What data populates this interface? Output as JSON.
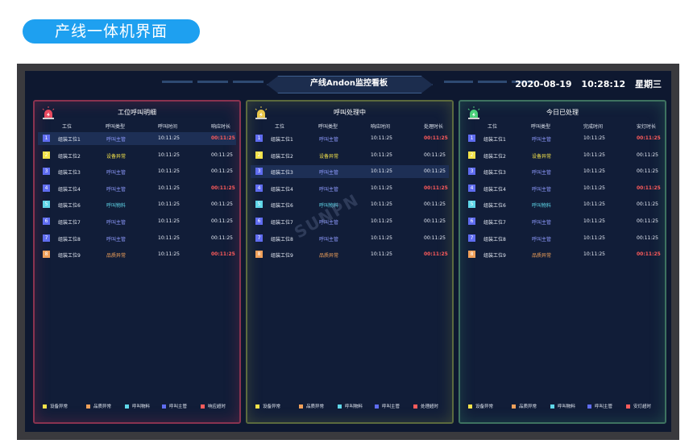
{
  "heading": "产线一体机界面",
  "screen_title": "产线Andon监控看板",
  "datetime": {
    "date": "2020-08-19",
    "time": "10:28:12",
    "weekday": "星期三"
  },
  "watermark": "SUNPN",
  "colors": {
    "equipment": "#f3e24a",
    "quality": "#f0a05a",
    "material": "#5fd6e8",
    "supervisor": "#5f6cf0",
    "timeout": "#ff5b5b"
  },
  "panels": [
    {
      "title": "工位呼叫明细",
      "icon": "red-alarm-icon",
      "headers": [
        "工位",
        "呼叫类型",
        "呼叫时间",
        "响应时长"
      ],
      "highlight_row": 0,
      "rows": [
        {
          "num": "1",
          "station": "组装工位1",
          "type": "呼叫主管",
          "type_color": "#8f9bff",
          "num_color": "#5f6cf0",
          "time": "10:11:25",
          "dur": "00:11:25",
          "timeout": true
        },
        {
          "num": "2",
          "station": "组装工位2",
          "type": "设备异常",
          "type_color": "#f3e24a",
          "num_color": "#f3e24a",
          "time": "10:11:25",
          "dur": "00:11:25",
          "timeout": false
        },
        {
          "num": "3",
          "station": "组装工位3",
          "type": "呼叫主管",
          "type_color": "#8f9bff",
          "num_color": "#5f6cf0",
          "time": "10:11:25",
          "dur": "00:11:25",
          "timeout": false
        },
        {
          "num": "4",
          "station": "组装工位4",
          "type": "呼叫主管",
          "type_color": "#8f9bff",
          "num_color": "#5f6cf0",
          "time": "10:11:25",
          "dur": "00:11:25",
          "timeout": true
        },
        {
          "num": "5",
          "station": "组装工位6",
          "type": "呼叫物料",
          "type_color": "#5fd6e8",
          "num_color": "#5fd6e8",
          "time": "10:11:25",
          "dur": "00:11:25",
          "timeout": false
        },
        {
          "num": "6",
          "station": "组装工位7",
          "type": "呼叫主管",
          "type_color": "#8f9bff",
          "num_color": "#5f6cf0",
          "time": "10:11:25",
          "dur": "00:11:25",
          "timeout": false
        },
        {
          "num": "7",
          "station": "组装工位8",
          "type": "呼叫主管",
          "type_color": "#8f9bff",
          "num_color": "#5f6cf0",
          "time": "10:11:25",
          "dur": "00:11:25",
          "timeout": false
        },
        {
          "num": "8",
          "station": "组装工位9",
          "type": "品质异常",
          "type_color": "#f0a05a",
          "num_color": "#f0a05a",
          "time": "10:11:25",
          "dur": "00:11:25",
          "timeout": true
        }
      ],
      "legend": [
        {
          "label": "设备异常",
          "color": "#f3e24a"
        },
        {
          "label": "品质异常",
          "color": "#f0a05a"
        },
        {
          "label": "呼叫物料",
          "color": "#5fd6e8"
        },
        {
          "label": "呼叫主管",
          "color": "#5f6cf0"
        },
        {
          "label": "响应超时",
          "color": "#ff5b5b"
        }
      ]
    },
    {
      "title": "呼叫处理中",
      "icon": "yellow-alarm-icon",
      "headers": [
        "工位",
        "呼叫类型",
        "响应时间",
        "处理时长"
      ],
      "highlight_row": 2,
      "rows": [
        {
          "num": "1",
          "station": "组装工位1",
          "type": "呼叫主管",
          "type_color": "#8f9bff",
          "num_color": "#5f6cf0",
          "time": "10:11:25",
          "dur": "00:11:25",
          "timeout": true
        },
        {
          "num": "2",
          "station": "组装工位2",
          "type": "设备异常",
          "type_color": "#f3e24a",
          "num_color": "#f3e24a",
          "time": "10:11:25",
          "dur": "00:11:25",
          "timeout": false
        },
        {
          "num": "3",
          "station": "组装工位3",
          "type": "呼叫主管",
          "type_color": "#8f9bff",
          "num_color": "#5f6cf0",
          "time": "10:11:25",
          "dur": "00:11:25",
          "timeout": false
        },
        {
          "num": "4",
          "station": "组装工位4",
          "type": "呼叫主管",
          "type_color": "#8f9bff",
          "num_color": "#5f6cf0",
          "time": "10:11:25",
          "dur": "00:11:25",
          "timeout": true
        },
        {
          "num": "5",
          "station": "组装工位6",
          "type": "呼叫物料",
          "type_color": "#5fd6e8",
          "num_color": "#5fd6e8",
          "time": "10:11:25",
          "dur": "00:11:25",
          "timeout": false
        },
        {
          "num": "6",
          "station": "组装工位7",
          "type": "呼叫主管",
          "type_color": "#8f9bff",
          "num_color": "#5f6cf0",
          "time": "10:11:25",
          "dur": "00:11:25",
          "timeout": false
        },
        {
          "num": "7",
          "station": "组装工位8",
          "type": "呼叫主管",
          "type_color": "#8f9bff",
          "num_color": "#5f6cf0",
          "time": "10:11:25",
          "dur": "00:11:25",
          "timeout": false
        },
        {
          "num": "8",
          "station": "组装工位9",
          "type": "品质异常",
          "type_color": "#f0a05a",
          "num_color": "#f0a05a",
          "time": "10:11:25",
          "dur": "00:11:25",
          "timeout": true
        }
      ],
      "legend": [
        {
          "label": "设备异常",
          "color": "#f3e24a"
        },
        {
          "label": "品质异常",
          "color": "#f0a05a"
        },
        {
          "label": "呼叫物料",
          "color": "#5fd6e8"
        },
        {
          "label": "呼叫主管",
          "color": "#5f6cf0"
        },
        {
          "label": "处理超时",
          "color": "#ff5b5b"
        }
      ]
    },
    {
      "title": "今日已处理",
      "icon": "green-alarm-icon",
      "headers": [
        "工位",
        "呼叫类型",
        "完成时间",
        "安灯时长"
      ],
      "highlight_row": -1,
      "rows": [
        {
          "num": "1",
          "station": "组装工位1",
          "type": "呼叫主管",
          "type_color": "#8f9bff",
          "num_color": "#5f6cf0",
          "time": "10:11:25",
          "dur": "00:11:25",
          "timeout": true
        },
        {
          "num": "2",
          "station": "组装工位2",
          "type": "设备异常",
          "type_color": "#f3e24a",
          "num_color": "#f3e24a",
          "time": "10:11:25",
          "dur": "00:11:25",
          "timeout": false
        },
        {
          "num": "3",
          "station": "组装工位3",
          "type": "呼叫主管",
          "type_color": "#8f9bff",
          "num_color": "#5f6cf0",
          "time": "10:11:25",
          "dur": "00:11:25",
          "timeout": false
        },
        {
          "num": "4",
          "station": "组装工位4",
          "type": "呼叫主管",
          "type_color": "#8f9bff",
          "num_color": "#5f6cf0",
          "time": "10:11:25",
          "dur": "00:11:25",
          "timeout": true
        },
        {
          "num": "5",
          "station": "组装工位6",
          "type": "呼叫物料",
          "type_color": "#5fd6e8",
          "num_color": "#5fd6e8",
          "time": "10:11:25",
          "dur": "00:11:25",
          "timeout": false
        },
        {
          "num": "6",
          "station": "组装工位7",
          "type": "呼叫主管",
          "type_color": "#8f9bff",
          "num_color": "#5f6cf0",
          "time": "10:11:25",
          "dur": "00:11:25",
          "timeout": false
        },
        {
          "num": "7",
          "station": "组装工位8",
          "type": "呼叫主管",
          "type_color": "#8f9bff",
          "num_color": "#5f6cf0",
          "time": "10:11:25",
          "dur": "00:11:25",
          "timeout": false
        },
        {
          "num": "8",
          "station": "组装工位9",
          "type": "品质异常",
          "type_color": "#f0a05a",
          "num_color": "#f0a05a",
          "time": "10:11:25",
          "dur": "00:11:25",
          "timeout": true
        }
      ],
      "legend": [
        {
          "label": "设备异常",
          "color": "#f3e24a"
        },
        {
          "label": "品质异常",
          "color": "#f0a05a"
        },
        {
          "label": "呼叫物料",
          "color": "#5fd6e8"
        },
        {
          "label": "呼叫主管",
          "color": "#5f6cf0"
        },
        {
          "label": "安灯超时",
          "color": "#ff5b5b"
        }
      ]
    }
  ]
}
